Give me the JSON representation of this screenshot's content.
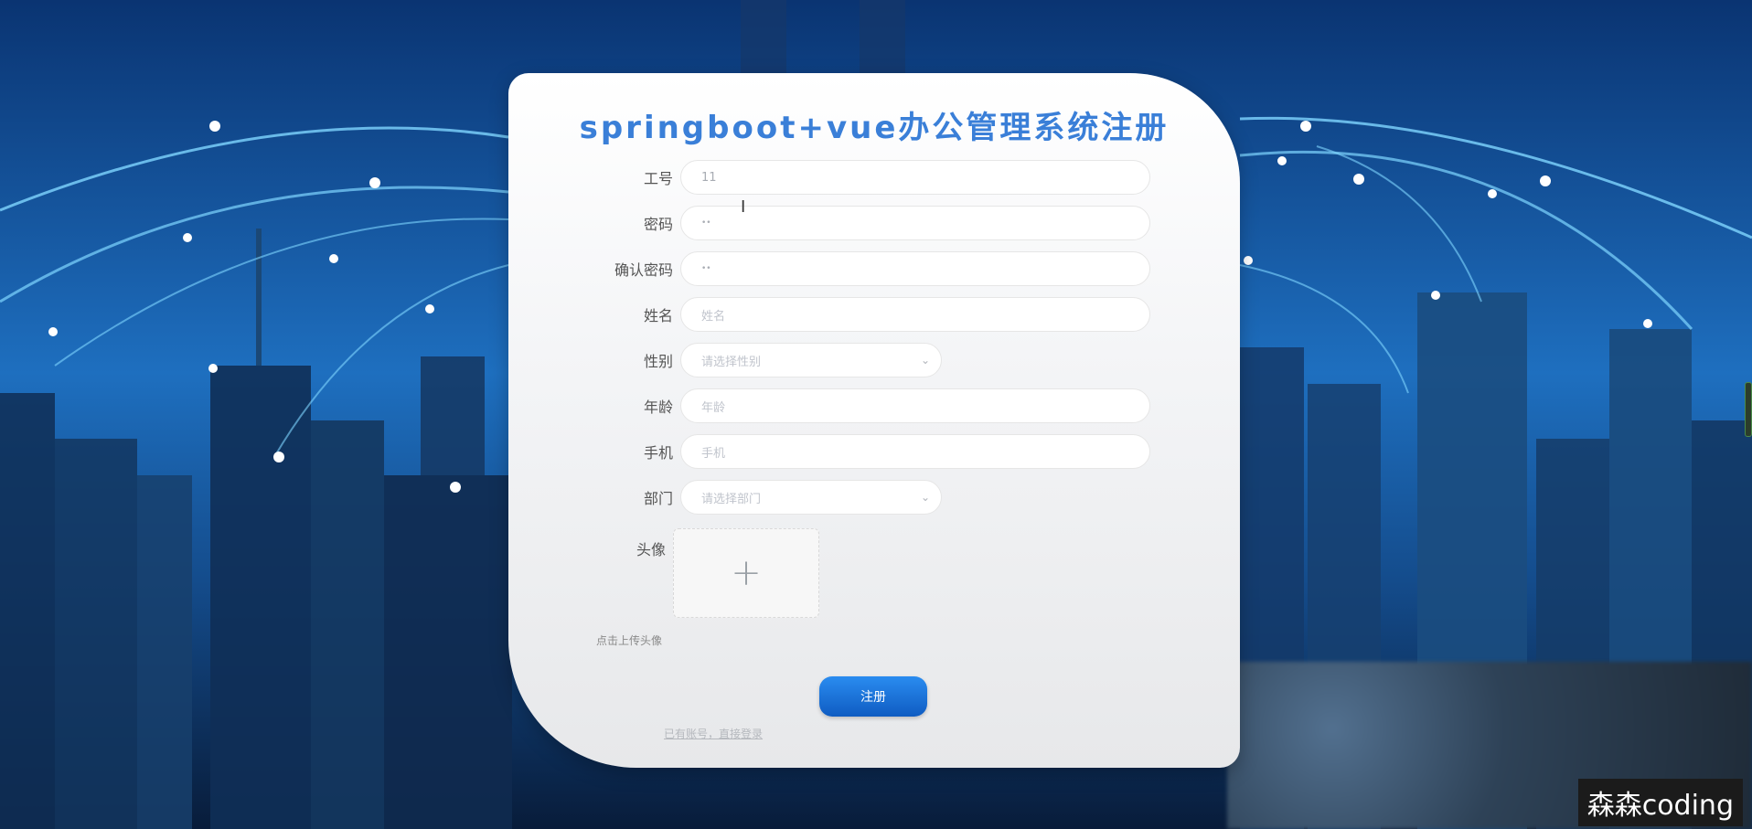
{
  "title": "springboot+vue办公管理系统注册",
  "fields": {
    "job_number": {
      "label": "工号",
      "value": "11"
    },
    "password": {
      "label": "密码",
      "value": "••"
    },
    "confirm_password": {
      "label": "确认密码",
      "value": "••"
    },
    "name": {
      "label": "姓名",
      "placeholder": "姓名"
    },
    "gender": {
      "label": "性别",
      "placeholder": "请选择性别"
    },
    "age": {
      "label": "年龄",
      "placeholder": "年龄"
    },
    "phone": {
      "label": "手机",
      "placeholder": "手机"
    },
    "department": {
      "label": "部门",
      "placeholder": "请选择部门"
    },
    "avatar": {
      "label": "头像",
      "hint": "点击上传头像"
    }
  },
  "buttons": {
    "submit": "注册"
  },
  "links": {
    "login": "已有账号，直接登录"
  },
  "watermark": "森森coding",
  "colors": {
    "title": "#3a7fd8",
    "button": "#1a75e0"
  },
  "icons": {
    "upload": "plus-icon",
    "select": "chevron-down-icon"
  }
}
